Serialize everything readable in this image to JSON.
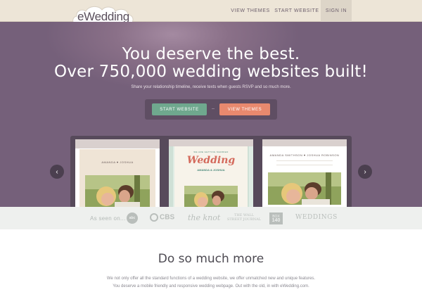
{
  "header": {
    "logo_text": "eWedding",
    "nav": {
      "view_themes": "VIEW THEMES",
      "start_website": "START WEBSITE",
      "sign_in": "SIGN IN"
    }
  },
  "hero": {
    "title_line1": "You deserve the best.",
    "title_line2": "Over 750,000 wedding websites built!",
    "subtitle": "Share your relationship timeline, receive texts when guests RSVP and so much more.",
    "start_button": "START WEBSITE",
    "themes_button": "VIEW THEMES",
    "arrow_left": "‹",
    "arrow_right": "›"
  },
  "themes": [
    {
      "names": "AMANDA ♥ JOSHUA"
    },
    {
      "script": "Wedding",
      "subline": "WE ARE GETTING MARRIED",
      "names": "AMANDA & JOSHUA"
    },
    {
      "names": "AMANDA SMITHSON ♥ JOSHUA ROBINSON"
    }
  ],
  "press": {
    "label": "As seen on...",
    "abc": "abc",
    "cbs": "CBS",
    "knot": "the knot",
    "wsj": "THE WALL STREET JOURNAL",
    "box_top": "BOX",
    "box_num": "140",
    "weddings": "WEDDINGS"
  },
  "more": {
    "title": "Do so much more",
    "line1": "We not only offer all the standard functions of a wedding website, we offer unmatched new and unique features.",
    "line2": "You deserve a mobile friendly and responsive wedding webpage. Out with the old, in with eWedding.com."
  },
  "colors": {
    "hero_bg": "#75607a",
    "start_green": "#6fa88e",
    "themes_coral": "#e8896e",
    "header_bg": "#ede5d7"
  }
}
